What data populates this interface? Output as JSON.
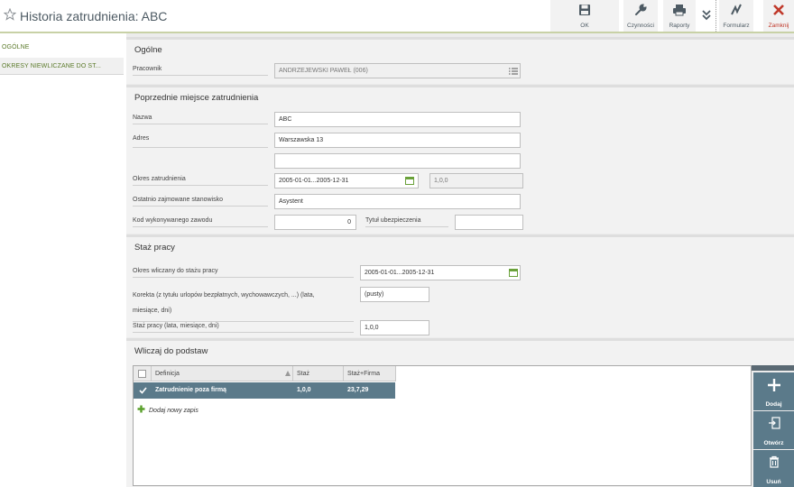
{
  "header": {
    "title": "Historia zatrudnienia: ABC",
    "toolbar": {
      "ok": "OK",
      "actions": "Czynności",
      "reports": "Raporty",
      "form": "Formularz",
      "close": "Zamknij"
    }
  },
  "sidebar": {
    "items": [
      {
        "label": "OGÓLNE"
      },
      {
        "label": "OKRESY NIEWLICZANE DO ST..."
      }
    ]
  },
  "general": {
    "title": "Ogólne",
    "employee_label": "Pracownik",
    "employee_value": "ANDRZEJEWSKI PAWEŁ (006)"
  },
  "previous": {
    "title": "Poprzednie miejsce zatrudnienia",
    "name_label": "Nazwa",
    "name_value": "ABC",
    "address_label": "Adres",
    "address_line1": "Warszawska 13",
    "address_line2": "",
    "period_label": "Okres zatrudnienia",
    "period_value": "2005-01-01...2005-12-31",
    "period_length": "1,0,0",
    "position_label": "Ostatnio zajmowane stanowisko",
    "position_value": "Asystent",
    "profession_label": "Kod wykonywanego zawodu",
    "profession_value": "0",
    "insurance_label": "Tytuł ubezpieczenia",
    "insurance_value": ""
  },
  "seniority": {
    "title": "Staż pracy",
    "period_label": "Okres wliczany do stażu pracy",
    "period_value": "2005-01-01...2005-12-31",
    "correction_label_1": "Korekta (z tytułu urlopów bezpłatnych, wychowawczych, ...) (lata,",
    "correction_label_2": "miesiące, dni)",
    "correction_value": "(pusty)",
    "total_label": "Staż pracy (lata, miesiące, dni)",
    "total_value": "1,0,0"
  },
  "include": {
    "title": "Wliczaj do podstaw",
    "columns": [
      "Definicja",
      "Staż",
      "Staż+Firma"
    ],
    "rows": [
      {
        "definition": "Zatrudnienie poza firmą",
        "seniority": "1,0,0",
        "seniority_company": "23,7,29"
      }
    ],
    "add_new": "Dodaj nowy zapis",
    "actions": {
      "add": "Dodaj",
      "open": "Otwórz",
      "delete": "Usuń"
    }
  },
  "colors": {
    "accent_green": "#5b7a2a",
    "selection": "#5b7a8a",
    "close_red": "#c0392b"
  },
  "icons": [
    "star-icon",
    "save-icon",
    "wrench-icon",
    "printer-icon",
    "chevron-down-icon",
    "form-icon",
    "close-icon",
    "list-icon",
    "calendar-icon",
    "check-icon",
    "plus-icon",
    "open-icon",
    "trash-icon"
  ]
}
